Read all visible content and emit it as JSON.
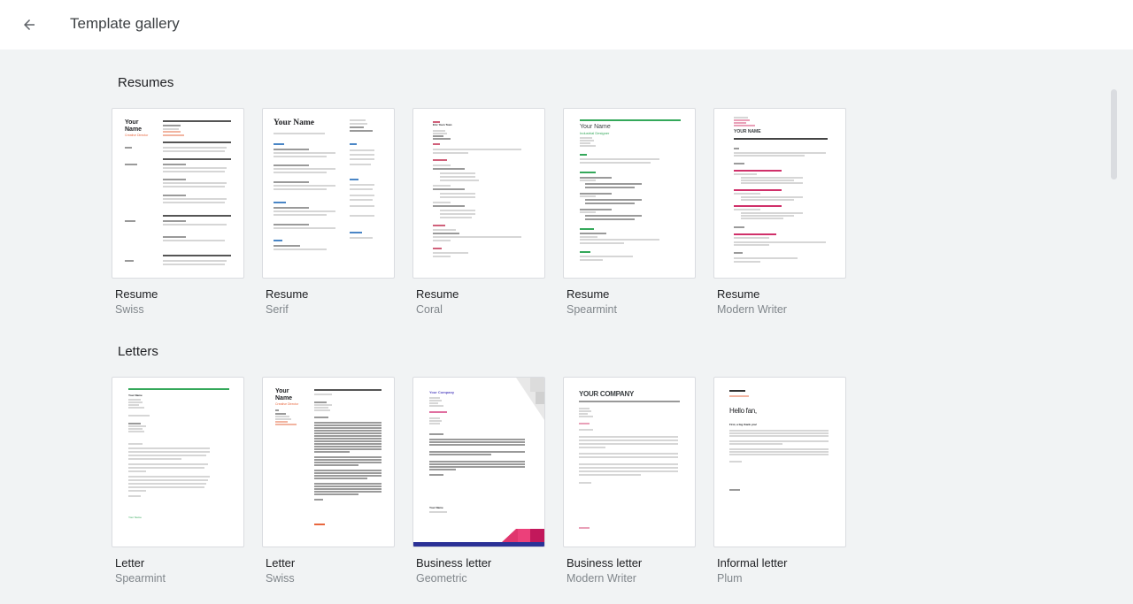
{
  "header": {
    "back_icon": "arrow-back-icon",
    "title": "Template gallery"
  },
  "sections": [
    {
      "title": "Resumes",
      "templates": [
        {
          "title": "Resume",
          "subtitle": "Swiss",
          "preview_heading": "Your Name",
          "preview_sub": "Creative Director",
          "accent": "#e8663d"
        },
        {
          "title": "Resume",
          "subtitle": "Serif",
          "preview_heading": "Your Name",
          "accent": "#4a86c6"
        },
        {
          "title": "Resume",
          "subtitle": "Coral",
          "preview_heading": "Eric Yuen Tuan",
          "accent": "#d0607a"
        },
        {
          "title": "Resume",
          "subtitle": "Spearmint",
          "preview_heading": "Your Name",
          "preview_sub": "Industrial Designer",
          "accent": "#34a85a"
        },
        {
          "title": "Resume",
          "subtitle": "Modern Writer",
          "preview_heading": "YOUR NAME",
          "accent": "#d0306a"
        }
      ]
    },
    {
      "title": "Letters",
      "templates": [
        {
          "title": "Letter",
          "subtitle": "Spearmint",
          "preview_heading": "Your Name",
          "preview_footer": "Your Name",
          "accent": "#34a85a"
        },
        {
          "title": "Letter",
          "subtitle": "Swiss",
          "preview_heading": "Your Name",
          "preview_sub": "Creative Director",
          "accent": "#e8663d"
        },
        {
          "title": "Business letter",
          "subtitle": "Geometric",
          "preview_heading": "Your Company",
          "preview_footer": "Your Name",
          "accent": "#5b4fc4"
        },
        {
          "title": "Business letter",
          "subtitle": "Modern Writer",
          "preview_heading": "YOUR COMPANY",
          "accent": "#d0306a"
        },
        {
          "title": "Informal letter",
          "subtitle": "Plum",
          "preview_heading": "Hello fan,",
          "preview_sub": "First, a big thank you!",
          "accent": "#e8663d"
        }
      ]
    }
  ],
  "colors": {
    "background": "#f1f3f4",
    "header_bg": "#ffffff",
    "title_text": "#202124",
    "subtitle_text": "#80868b"
  }
}
